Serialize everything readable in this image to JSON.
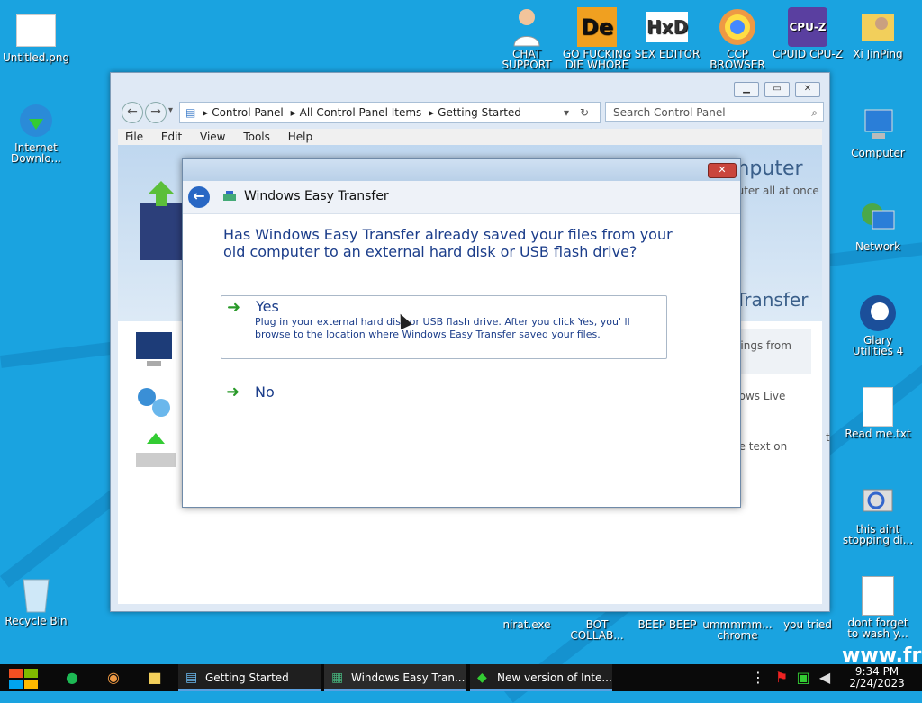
{
  "desktop": {
    "icons": [
      {
        "label": "Untitled.png",
        "icon": "image-file-icon"
      },
      {
        "label": "Internet Downlo...",
        "icon": "download-globe-icon"
      },
      {
        "label": "Recycle Bin",
        "icon": "recycle-bin-icon"
      },
      {
        "label": "CHAT SUPPORT",
        "icon": "doctor-icon"
      },
      {
        "label": "GO FUCKING DIE WHORE",
        "icon": "de-icon"
      },
      {
        "label": "SEX EDITOR",
        "icon": "hxd-icon"
      },
      {
        "label": "CCP BROWSER",
        "icon": "chrome-like-icon"
      },
      {
        "label": "CPUID CPU-Z",
        "icon": "cpuz-icon"
      },
      {
        "label": "Xi JinPing",
        "icon": "folder-person-icon"
      },
      {
        "label": "Computer",
        "icon": "computer-icon"
      },
      {
        "label": "Network",
        "icon": "network-icon"
      },
      {
        "label": "Glary Utilities 4",
        "icon": "glary-icon"
      },
      {
        "label": "Read me.txt",
        "icon": "text-file-icon"
      },
      {
        "label": "this aint stopping di...",
        "icon": "magnifier-computer-icon"
      },
      {
        "label": "dont forget to wash y...",
        "icon": "calendar-file-icon"
      },
      {
        "label": "nirat.exe",
        "icon": "exe-icon"
      },
      {
        "label": "BOT COLLAB...",
        "icon": "bot-icon"
      },
      {
        "label": "BEEP BEEP",
        "icon": "beep-icon"
      },
      {
        "label": "ummmmm... chrome",
        "icon": "chrome-icon"
      },
      {
        "label": "you tried",
        "icon": "file-icon"
      }
    ],
    "partial_text": "www.fr"
  },
  "cp_window": {
    "breadcrumb": [
      "Control Panel",
      "All Control Panel Items",
      "Getting Started"
    ],
    "search_placeholder": "Search Control Panel",
    "menu": [
      "File",
      "Edit",
      "View",
      "Tools",
      "Help"
    ],
    "banner_title": "mputer",
    "banner_sub": "puter all at once",
    "banner_transfer": "Transfer",
    "side_texts": [
      "ttings from",
      "dows Live",
      "he text on"
    ],
    "side_letter": "t"
  },
  "dialog": {
    "title": "Windows Easy Transfer",
    "question": "Has Windows Easy Transfer already saved your files from your old computer to an external hard disk or USB flash drive?",
    "yes_label": "Yes",
    "yes_desc": "Plug in your external hard disk or USB flash drive.  After you click Yes, you' ll browse to the location where Windows Easy Transfer saved your files.",
    "no_label": "No",
    "close_glyph": "✕",
    "back_glyph": "←"
  },
  "taskbar": {
    "tasks": [
      {
        "label": "Getting Started",
        "icon": "control-panel-icon"
      },
      {
        "label": "Windows Easy Tran...",
        "icon": "easy-transfer-icon"
      },
      {
        "label": "New version of Inte...",
        "icon": "idm-icon"
      }
    ],
    "time": "9:34 PM",
    "date": "2/24/2023"
  },
  "colors": {
    "desktop_bg": "#1aa3e0",
    "accent": "#1b3d8a",
    "arrow": "#2a9a2a"
  }
}
